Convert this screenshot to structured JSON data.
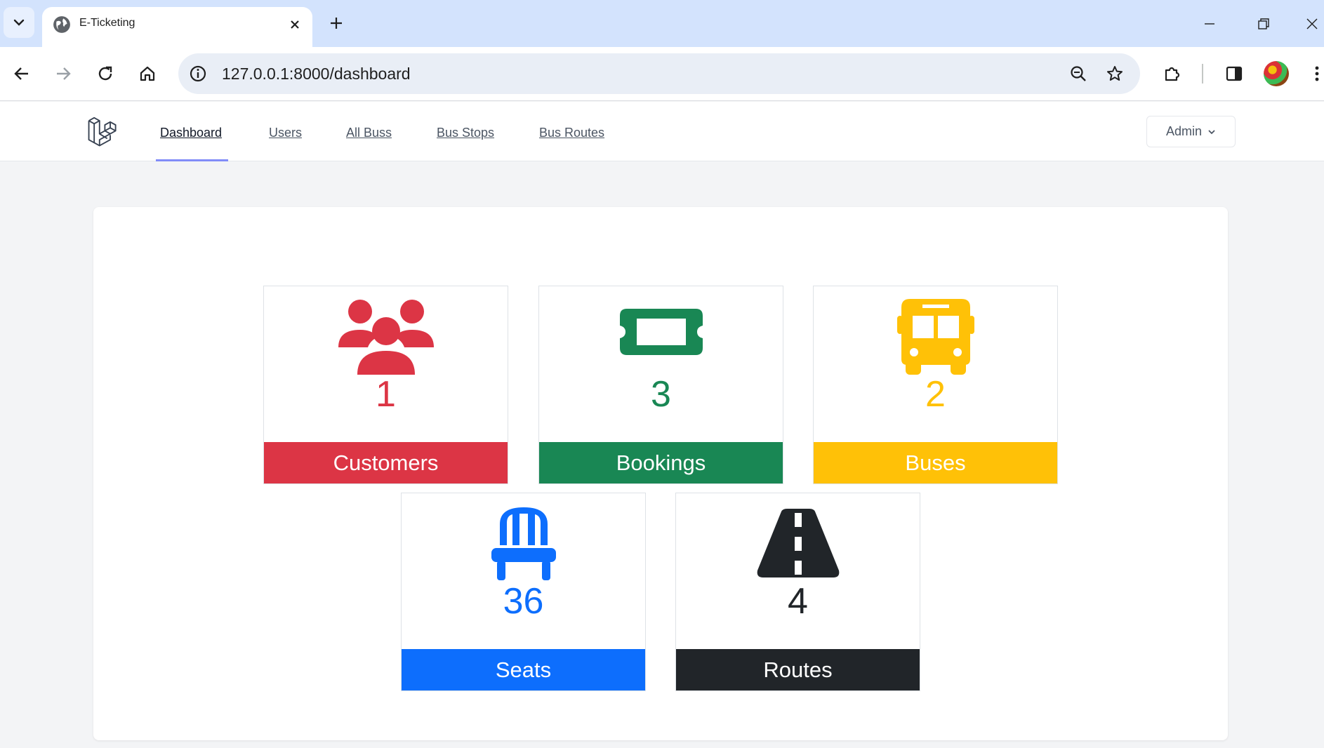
{
  "browser": {
    "tab_title": "E-Ticketing",
    "url": "127.0.0.1:8000/dashboard"
  },
  "nav": {
    "links": [
      {
        "label": "Dashboard",
        "active": true
      },
      {
        "label": "Users",
        "active": false
      },
      {
        "label": "All Buss",
        "active": false
      },
      {
        "label": "Bus Stops",
        "active": false
      },
      {
        "label": "Bus Routes",
        "active": false
      }
    ],
    "user_menu": "Admin"
  },
  "stats": [
    {
      "label": "Customers",
      "count": "1",
      "color": "#dc3545",
      "icon": "users-icon"
    },
    {
      "label": "Bookings",
      "count": "3",
      "color": "#198754",
      "icon": "ticket-icon"
    },
    {
      "label": "Buses",
      "count": "2",
      "color": "#ffc107",
      "icon": "bus-icon"
    },
    {
      "label": "Seats",
      "count": "36",
      "color": "#0d6efd",
      "icon": "chair-icon"
    },
    {
      "label": "Routes",
      "count": "4",
      "color": "#212529",
      "icon": "road-icon"
    }
  ]
}
